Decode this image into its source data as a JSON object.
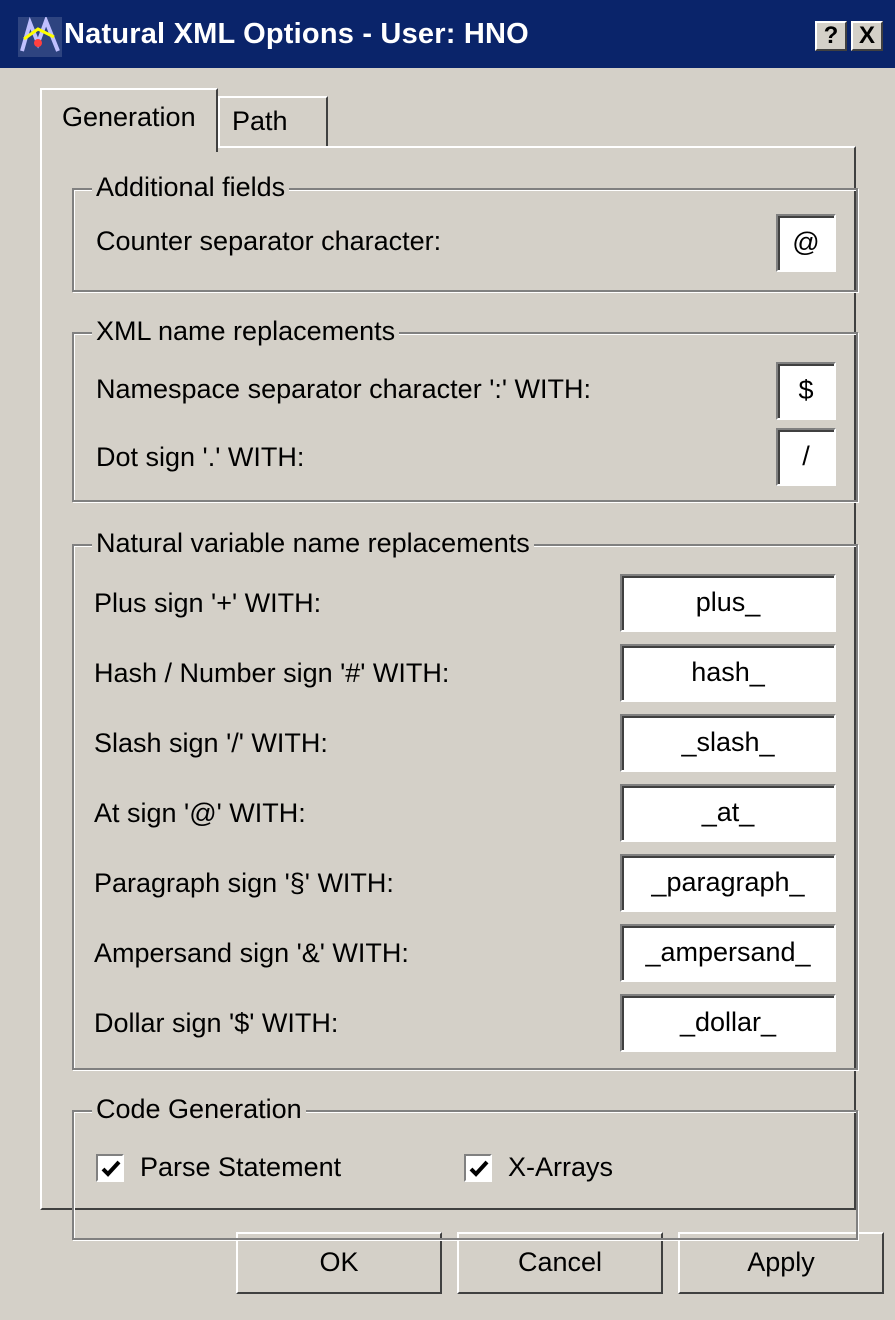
{
  "window": {
    "title": "Natural  XML Options - User: HNO",
    "help_label": "?",
    "close_label": "X"
  },
  "tabs": [
    {
      "label": "Generation",
      "active": true
    },
    {
      "label": "Path",
      "active": false
    }
  ],
  "additional_fields": {
    "legend": "Additional fields",
    "counter_separator_label": "Counter separator character:",
    "counter_separator_value": "@"
  },
  "xml_name_replacements": {
    "legend": "XML name replacements",
    "namespace_label": "Namespace separator character ':' WITH:",
    "namespace_value": "$",
    "dot_label": "Dot sign '.' WITH:",
    "dot_value": "/"
  },
  "natural_variable_replacements": {
    "legend": "Natural variable name replacements",
    "rows": [
      {
        "label": "Plus sign '+'  WITH:",
        "value": "plus_"
      },
      {
        "label": "Hash / Number sign '#' WITH:",
        "value": "hash_"
      },
      {
        "label": "Slash sign '/' WITH:",
        "value": "_slash_"
      },
      {
        "label": "At sign '@' WITH:",
        "value": "_at_"
      },
      {
        "label": "Paragraph sign '§' WITH:",
        "value": "_paragraph_"
      },
      {
        "label": "Ampersand sign '&' WITH:",
        "value": "_ampersand_"
      },
      {
        "label": "Dollar sign '$' WITH:",
        "value": "_dollar_"
      }
    ]
  },
  "code_generation": {
    "legend": "Code Generation",
    "parse_statement_label": "Parse Statement",
    "parse_statement_checked": true,
    "x_arrays_label": "X-Arrays",
    "x_arrays_checked": true
  },
  "buttons": {
    "ok": "OK",
    "cancel": "Cancel",
    "apply": "Apply"
  },
  "colors": {
    "titlebar": "#0a246a",
    "face": "#d4d0c8"
  }
}
